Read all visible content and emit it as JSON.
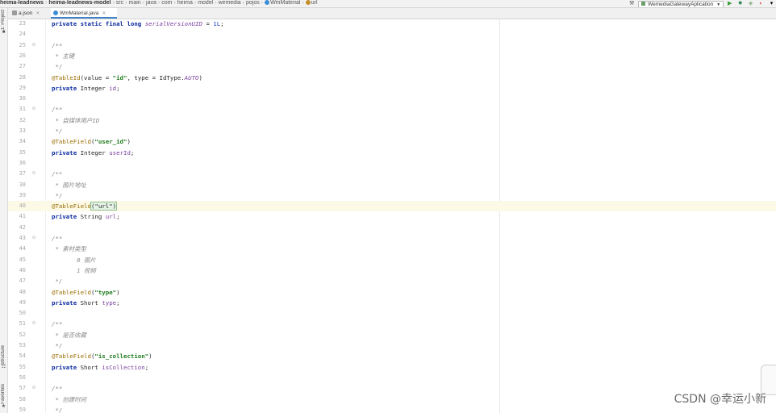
{
  "breadcrumb": [
    {
      "label": "heima-leadnews",
      "bold": true
    },
    {
      "label": "heima-leadnews-model",
      "bold": true
    },
    {
      "label": "src"
    },
    {
      "label": "main"
    },
    {
      "label": "java"
    },
    {
      "label": "com"
    },
    {
      "label": "heima"
    },
    {
      "label": "model"
    },
    {
      "label": "wemedia"
    },
    {
      "label": "pojos"
    },
    {
      "label": "WmMaterial",
      "icon": "class"
    },
    {
      "label": "url",
      "icon": "field"
    }
  ],
  "toolbar": {
    "run_config": "WemediaGatewayAplication"
  },
  "tool_windows": {
    "project": "1: Project",
    "structure": "Structure",
    "favorites": "Favorites"
  },
  "tabs": [
    {
      "label": "a.json",
      "active": false
    },
    {
      "label": "WmMaterial.java",
      "active": true
    }
  ],
  "code": [
    {
      "n": "23",
      "t": [
        [
          "k",
          "private static final long "
        ],
        [
          "fi",
          "serialVersionUID"
        ],
        [
          "p",
          " = "
        ],
        [
          "n",
          "1L"
        ],
        [
          "p",
          ";"
        ]
      ]
    },
    {
      "n": "24",
      "t": []
    },
    {
      "n": "25",
      "fold": true,
      "t": [
        [
          "c",
          "/**"
        ]
      ]
    },
    {
      "n": "26",
      "t": [
        [
          "c",
          " * 主键"
        ]
      ]
    },
    {
      "n": "27",
      "t": [
        [
          "c",
          " */"
        ]
      ]
    },
    {
      "n": "28",
      "t": [
        [
          "a",
          "@TableId"
        ],
        [
          "p",
          "(value = "
        ],
        [
          "s",
          "\"id\""
        ],
        [
          "p",
          ", type = IdType."
        ],
        [
          "fi",
          "AUTO"
        ],
        [
          "p",
          ")"
        ]
      ]
    },
    {
      "n": "29",
      "t": [
        [
          "k",
          "private "
        ],
        [
          "p",
          "Integer "
        ],
        [
          "f",
          "id"
        ],
        [
          "p",
          ";"
        ]
      ]
    },
    {
      "n": "30",
      "t": []
    },
    {
      "n": "31",
      "fold": true,
      "t": [
        [
          "c",
          "/**"
        ]
      ]
    },
    {
      "n": "32",
      "t": [
        [
          "c",
          " * 自媒体用户ID"
        ]
      ]
    },
    {
      "n": "33",
      "t": [
        [
          "c",
          " */"
        ]
      ]
    },
    {
      "n": "34",
      "t": [
        [
          "a",
          "@TableField"
        ],
        [
          "p",
          "("
        ],
        [
          "s",
          "\"user_id\""
        ],
        [
          "p",
          ")"
        ]
      ]
    },
    {
      "n": "35",
      "t": [
        [
          "k",
          "private "
        ],
        [
          "p",
          "Integer "
        ],
        [
          "f",
          "userId"
        ],
        [
          "p",
          ";"
        ]
      ]
    },
    {
      "n": "36",
      "t": []
    },
    {
      "n": "37",
      "fold": true,
      "t": [
        [
          "c",
          "/**"
        ]
      ]
    },
    {
      "n": "38",
      "t": [
        [
          "c",
          " * 图片地址"
        ]
      ]
    },
    {
      "n": "39",
      "t": [
        [
          "c",
          " */"
        ]
      ]
    },
    {
      "n": "40",
      "hl": true,
      "t": [
        [
          "a",
          "@TableField"
        ],
        [
          "brk",
          "(\"url\")"
        ]
      ]
    },
    {
      "n": "41",
      "t": [
        [
          "k",
          "private "
        ],
        [
          "p",
          "String "
        ],
        [
          "f",
          "url"
        ],
        [
          "p",
          ";"
        ]
      ]
    },
    {
      "n": "42",
      "t": []
    },
    {
      "n": "43",
      "fold": true,
      "t": [
        [
          "c",
          "/**"
        ]
      ]
    },
    {
      "n": "44",
      "t": [
        [
          "c",
          " * 素材类型"
        ]
      ]
    },
    {
      "n": "45",
      "t": [
        [
          "c",
          "       0 图片"
        ]
      ]
    },
    {
      "n": "46",
      "t": [
        [
          "c",
          "       1 视频"
        ]
      ]
    },
    {
      "n": "47",
      "t": [
        [
          "c",
          " */"
        ]
      ]
    },
    {
      "n": "48",
      "t": [
        [
          "a",
          "@TableField"
        ],
        [
          "p",
          "("
        ],
        [
          "s",
          "\"type\""
        ],
        [
          "p",
          ")"
        ]
      ]
    },
    {
      "n": "49",
      "t": [
        [
          "k",
          "private "
        ],
        [
          "p",
          "Short "
        ],
        [
          "f",
          "type"
        ],
        [
          "p",
          ";"
        ]
      ]
    },
    {
      "n": "50",
      "t": []
    },
    {
      "n": "51",
      "fold": true,
      "t": [
        [
          "c",
          "/**"
        ]
      ]
    },
    {
      "n": "52",
      "t": [
        [
          "c",
          " * 是否收藏"
        ]
      ]
    },
    {
      "n": "53",
      "t": [
        [
          "c",
          " */"
        ]
      ]
    },
    {
      "n": "54",
      "t": [
        [
          "a",
          "@TableField"
        ],
        [
          "p",
          "("
        ],
        [
          "s",
          "\"is_collection\""
        ],
        [
          "p",
          ")"
        ]
      ]
    },
    {
      "n": "55",
      "t": [
        [
          "k",
          "private "
        ],
        [
          "p",
          "Short "
        ],
        [
          "f",
          "isCollection"
        ],
        [
          "p",
          ";"
        ]
      ]
    },
    {
      "n": "56",
      "t": []
    },
    {
      "n": "57",
      "fold": true,
      "t": [
        [
          "c",
          "/**"
        ]
      ]
    },
    {
      "n": "58",
      "t": [
        [
          "c",
          " * 创建时间"
        ]
      ]
    },
    {
      "n": "59",
      "t": [
        [
          "c",
          " */"
        ]
      ]
    }
  ],
  "watermark": "CSDN @幸运小新"
}
